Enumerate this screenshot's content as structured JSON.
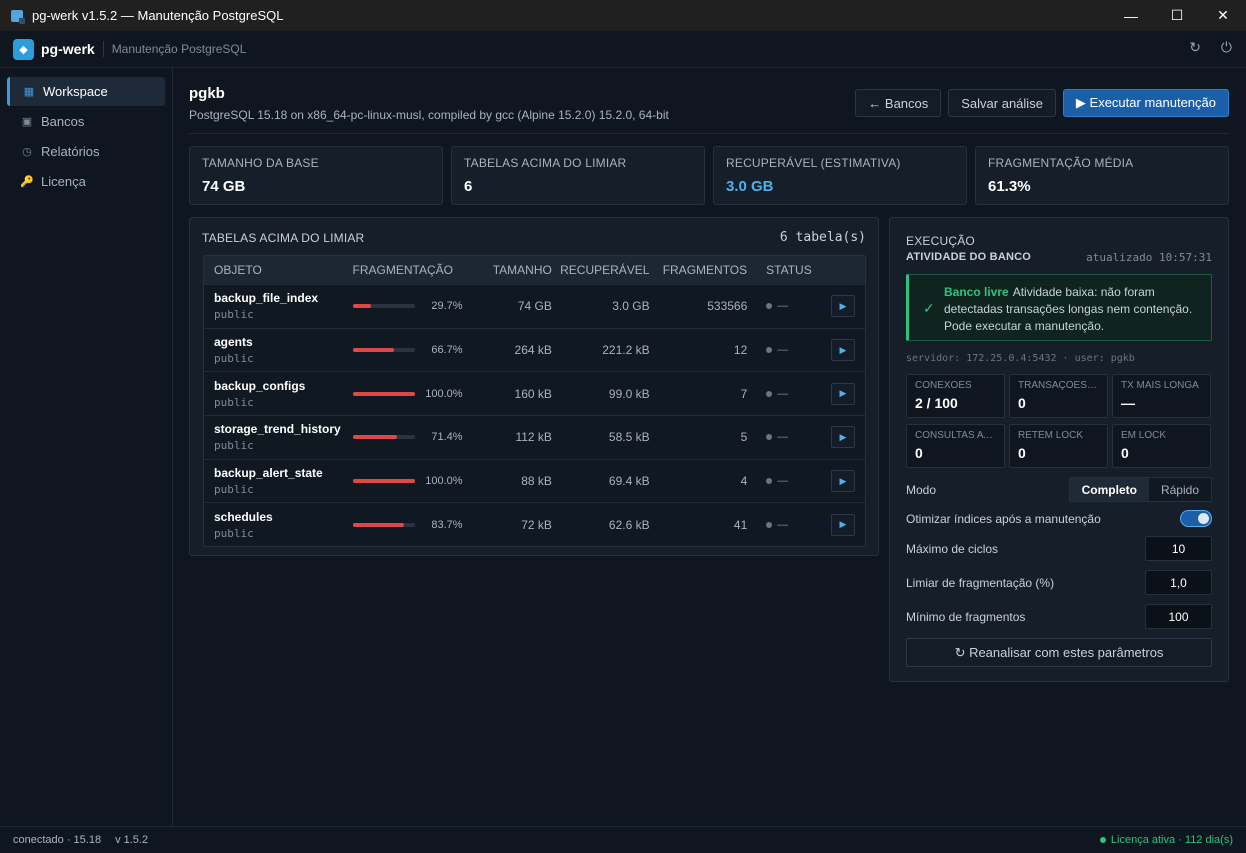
{
  "window": {
    "title": "pg-werk v1.5.2 — Manutenção PostgreSQL",
    "minimize": "—",
    "maximize": "☐",
    "close": "✕"
  },
  "header": {
    "brand": "pg-werk",
    "subtitle": "Manutenção PostgreSQL",
    "refresh_icon": "↻",
    "power_icon": "⏻"
  },
  "sidebar": {
    "items": [
      {
        "label": "Workspace",
        "icon": "▦",
        "icon_name": "grid-icon"
      },
      {
        "label": "Bancos",
        "icon": "▣",
        "icon_name": "database-icon"
      },
      {
        "label": "Relatórios",
        "icon": "◷",
        "icon_name": "clock-icon"
      },
      {
        "label": "Licença",
        "icon": "🔑",
        "icon_name": "key-icon"
      }
    ]
  },
  "main": {
    "db_name": "pgkb",
    "db_version": "PostgreSQL 15.18 on x86_64-pc-linux-musl, compiled by gcc (Alpine 15.2.0) 15.2.0, 64-bit",
    "actions": {
      "back": "← Bancos",
      "save": "Salvar análise",
      "run": "▶ Executar manutenção"
    },
    "stats": [
      {
        "label": "TAMANHO DA BASE",
        "value": "74 GB"
      },
      {
        "label": "TABELAS ACIMA DO LIMIAR",
        "value": "6"
      },
      {
        "label": "RECUPERÁVEL (ESTIMATIVA)",
        "value": "3.0 GB"
      },
      {
        "label": "FRAGMENTAÇÃO MÉDIA",
        "value": "61.3%"
      }
    ],
    "table": {
      "title": "TABELAS ACIMA DO LIMIAR",
      "count": "6 tabela(s)",
      "columns": [
        "OBJETO",
        "FRAGMENTAÇÃO",
        "TAMANHO",
        "RECUPERÁVEL",
        "FRAGMENTOS",
        "STATUS"
      ],
      "rows": [
        {
          "name": "backup_file_index",
          "schema": "public",
          "frag": "29.7%",
          "frag_value": 0.297,
          "size": "74 GB",
          "recoverable": "3.0 GB",
          "fragments": "533566",
          "status": "—"
        },
        {
          "name": "agents",
          "schema": "public",
          "frag": "66.7%",
          "frag_value": 0.667,
          "size": "264 kB",
          "recoverable": "221.2 kB",
          "fragments": "12",
          "status": "—"
        },
        {
          "name": "backup_configs",
          "schema": "public",
          "frag": "100.0%",
          "frag_value": 1.0,
          "size": "160 kB",
          "recoverable": "99.0 kB",
          "fragments": "7",
          "status": "—"
        },
        {
          "name": "storage_trend_history",
          "schema": "public",
          "frag": "71.4%",
          "frag_value": 0.714,
          "size": "112 kB",
          "recoverable": "58.5 kB",
          "fragments": "5",
          "status": "—"
        },
        {
          "name": "backup_alert_state",
          "schema": "public",
          "frag": "100.0%",
          "frag_value": 1.0,
          "size": "88 kB",
          "recoverable": "69.4 kB",
          "fragments": "4",
          "status": "—"
        },
        {
          "name": "schedules",
          "schema": "public",
          "frag": "83.7%",
          "frag_value": 0.837,
          "size": "72 kB",
          "recoverable": "62.6 kB",
          "fragments": "41",
          "status": "—"
        }
      ]
    }
  },
  "execution": {
    "title": "EXECUÇÃO",
    "activity_title": "ATIVIDADE DO BANCO",
    "updated": "atualizado 10:57:31",
    "alert_strong": "Banco livre",
    "alert_text": "Atividade baixa: não foram detectadas transações longas nem contenção. Pode executar a manutenção.",
    "alert_check": "✓",
    "server": "servidor: 172.25.0.4:5432 · user: pgkb",
    "metrics": [
      {
        "label": "CONEXÕES",
        "value": "2 / 100"
      },
      {
        "label": "TRANSAÇÕES A...",
        "value": "0"
      },
      {
        "label": "TX MAIS LONGA",
        "value": "—"
      },
      {
        "label": "CONSULTAS AT...",
        "value": "0"
      },
      {
        "label": "RETÊM LOCK",
        "value": "0"
      },
      {
        "label": "EM LOCK",
        "value": "0"
      }
    ],
    "mode_label": "Modo",
    "mode_full": "Completo",
    "mode_fast": "Rápido",
    "optimize_label": "Otimizar índices após a manutenção",
    "optimize_on": true,
    "max_cycles_label": "Máximo de ciclos",
    "max_cycles": "10",
    "frag_threshold_label": "Limiar de fragmentação (%)",
    "frag_threshold": "1,0",
    "min_fragments_label": "Mínimo de fragmentos",
    "min_fragments": "100",
    "reanalyze": "↻ Reanalisar com estes parâmetros"
  },
  "statusbar": {
    "connection": "conectado · 15.18",
    "version": "v 1.5.2",
    "license": "Licença ativa · 112 dia(s)"
  },
  "colors": {
    "accent": "#1b5fa8",
    "danger_bar": "#e04848",
    "success": "#2ec27e",
    "recoverable": "#4fb0ec"
  }
}
